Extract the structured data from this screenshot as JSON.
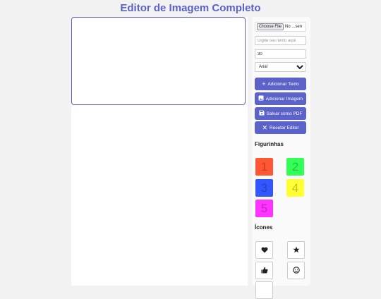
{
  "page": {
    "title": "Editor de Imagem Completo"
  },
  "controls": {
    "file_button": "Choose File",
    "file_status": "No ...sen",
    "text_placeholder": "Digite seu texto aqui",
    "font_size": "30",
    "font_family": "Arial",
    "font_options": [
      "Arial"
    ]
  },
  "buttons": {
    "add_text": "Adicionar Texto",
    "add_image": "Adicionar Imagem",
    "save_pdf": "Salvar como PDF",
    "reset": "Resetar Editor"
  },
  "stickers": {
    "title": "Figurinhas",
    "items": [
      {
        "label": "1",
        "color": "#ff5733"
      },
      {
        "label": "2",
        "color": "#33ff57"
      },
      {
        "label": "3",
        "color": "#3357ff"
      },
      {
        "label": "4",
        "color": "#ffff33"
      },
      {
        "label": "5",
        "color": "#ff33ff"
      }
    ]
  },
  "icons": {
    "title": "Ícones",
    "items": [
      "heart-icon",
      "star-icon",
      "thumbs-up-icon",
      "smile-icon"
    ]
  }
}
